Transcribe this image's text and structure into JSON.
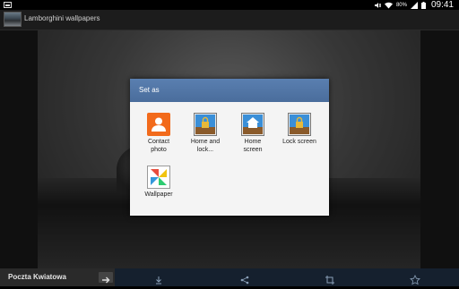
{
  "status": {
    "battery_percent": "80%",
    "time": "09:41"
  },
  "action_bar": {
    "title": "Lamborghini wallpapers"
  },
  "dialog": {
    "title": "Set as",
    "options": [
      {
        "label_line1": "Contact",
        "label_line2": "photo",
        "icon": "contact-icon"
      },
      {
        "label_line1": "Home and",
        "label_line2": "lock...",
        "icon": "home-and-lock-icon"
      },
      {
        "label_line1": "Home",
        "label_line2": "screen",
        "icon": "home-screen-icon"
      },
      {
        "label_line1": "Lock screen",
        "label_line2": "",
        "icon": "lock-screen-icon"
      },
      {
        "label_line1": "Wallpaper",
        "label_line2": "",
        "icon": "wallpaper-icon"
      }
    ]
  },
  "bottom_bar": {
    "left_label": "Poczta Kwiatowa",
    "buttons": [
      "download-icon",
      "share-icon",
      "crop-icon",
      "favorite-icon"
    ]
  },
  "colors": {
    "dialog_header": "#4a6d9c",
    "toolbar": "#15202e",
    "contact_accent": "#f26a1b"
  }
}
